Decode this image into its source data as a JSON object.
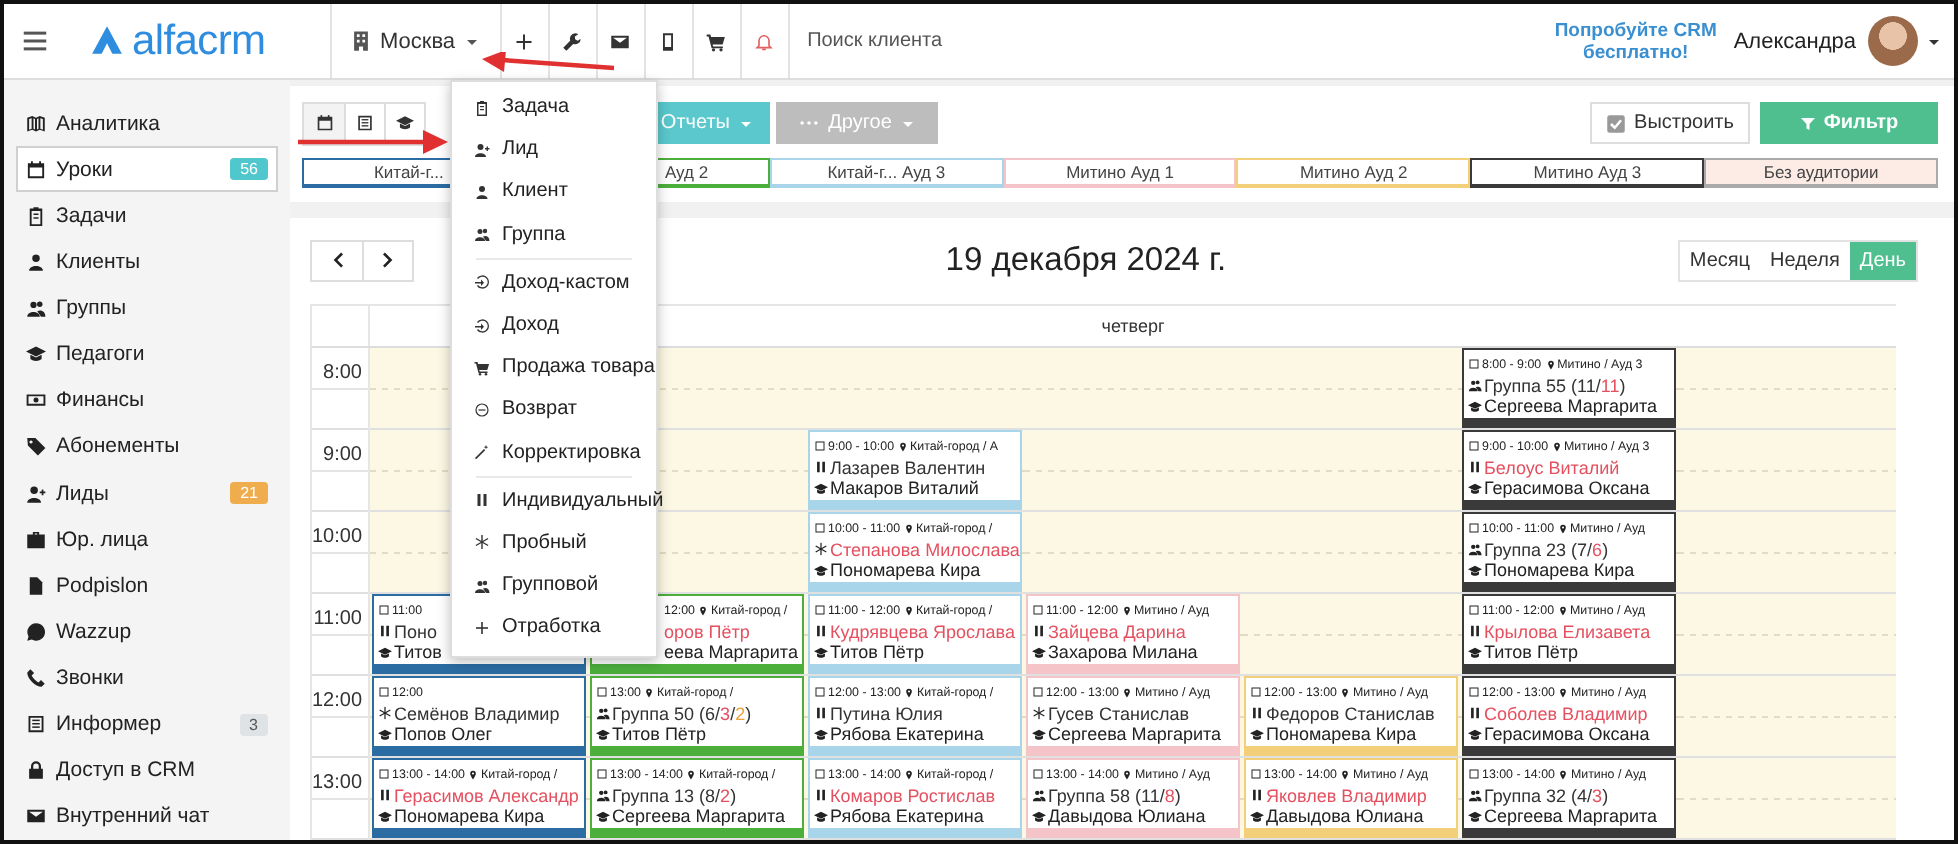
{
  "header": {
    "logo": "alfacrm",
    "city": "Москва",
    "search": {
      "placeholder": "Поиск клиента"
    },
    "promo": "Попробуйте CRM бесплатно!",
    "user": "Александра"
  },
  "sidebar": {
    "items": [
      {
        "label": "Аналитика",
        "selected": false
      },
      {
        "label": "Уроки",
        "selected": true,
        "badge": {
          "text": "56",
          "color": "#4fc7cc"
        }
      },
      {
        "label": "Задачи",
        "selected": false
      },
      {
        "label": "Клиенты",
        "selected": false
      },
      {
        "label": "Группы",
        "selected": false
      },
      {
        "label": "Педагоги",
        "selected": false
      },
      {
        "label": "Финансы",
        "selected": false
      },
      {
        "label": "Абонементы",
        "selected": false
      },
      {
        "label": "Лиды",
        "selected": false,
        "badge": {
          "text": "21",
          "color": "#f0ad4e"
        }
      },
      {
        "label": "Юр. лица",
        "selected": false
      },
      {
        "label": "Podpislon",
        "selected": false
      },
      {
        "label": "Wazzup",
        "selected": false
      },
      {
        "label": "Звонки",
        "selected": false
      },
      {
        "label": "Информер",
        "selected": false,
        "badge": {
          "text": "3",
          "color": "#dfe3e6"
        }
      },
      {
        "label": "Доступ в CRM",
        "selected": false
      },
      {
        "label": "Внутренний чат",
        "selected": false
      }
    ]
  },
  "add_menu": {
    "sections": [
      [
        {
          "label": "Задача"
        },
        {
          "label": "Лид"
        },
        {
          "label": "Клиент"
        },
        {
          "label": "Группа"
        }
      ],
      [
        {
          "label": "Доход-кастом"
        },
        {
          "label": "Доход"
        },
        {
          "label": "Продажа товара"
        },
        {
          "label": "Возврат"
        },
        {
          "label": "Корректировка"
        }
      ],
      [
        {
          "label": "Индивидуальный"
        },
        {
          "label": "Пробный"
        },
        {
          "label": "Групповой"
        },
        {
          "label": "Отработка"
        }
      ]
    ]
  },
  "toolbar": {
    "reports_button": "Отчеты",
    "other_button": "Другое",
    "arrange": {
      "label": "Выстроить",
      "checked": true
    },
    "filter_button": "Фильтр"
  },
  "rooms_legend": [
    {
      "label": "Китай-г...",
      "color": "#2b6ca3"
    },
    {
      "label": "Ауд 2",
      "color": "#4caf3c"
    },
    {
      "label": "Китай-г... Ауд 3",
      "color": "#a9d5ea"
    },
    {
      "label": "Митино Ауд 1",
      "color": "#f5c4c8"
    },
    {
      "label": "Митино Ауд 2",
      "color": "#f3cf7a"
    },
    {
      "label": "Митино Ауд 3",
      "color": "#3a3a3a"
    },
    {
      "label": "Без аудитории",
      "color": "#aaaaaa"
    }
  ],
  "calendar": {
    "title": "19 декабря 2024 г.",
    "views": [
      {
        "label": "Месяц",
        "selected": false
      },
      {
        "label": "Неделя",
        "selected": false
      },
      {
        "label": "День",
        "selected": true
      }
    ],
    "day": "четверг",
    "hours": [
      "8:00",
      "9:00",
      "10:00",
      "11:00",
      "12:00",
      "13:00"
    ],
    "columns": [
      {
        "color": "#2b6ca3",
        "cells": [
          {
            "kind": "empty"
          },
          {
            "kind": "empty"
          },
          {
            "kind": "empty"
          },
          {
            "kind": "individual",
            "time": "11:00",
            "name_parts": [
              {
                "text": "Поно",
                "color": "#333333"
              }
            ],
            "teacher": "Титов"
          },
          {
            "kind": "trial",
            "time": "12:00",
            "name_parts": [
              {
                "text": "Семёнов Владимир",
                "color": "#333333"
              }
            ],
            "teacher": "Попов Олег"
          },
          {
            "kind": "individual",
            "time": "13:00 - 14:00",
            "location": "Китай-город /",
            "name_parts": [
              {
                "text": "Герасимов Александр",
                "color": "#e4505f"
              }
            ],
            "teacher": "Пономарева Кира"
          }
        ]
      },
      {
        "color": "#4caf3c",
        "cells": [
          {
            "kind": "empty"
          },
          {
            "kind": "empty"
          },
          {
            "kind": "empty"
          },
          {
            "kind": "unknown",
            "time": "12:00",
            "location": "Китай-город /",
            "name_parts": [
              {
                "text": "оров Пётр",
                "color": "#e4505f"
              }
            ],
            "teacher": "еева Маргарита"
          },
          {
            "kind": "group",
            "time": "13:00",
            "location": "Китай-город /",
            "name_parts": [
              {
                "text": "Группа 50 (6/",
                "color": "#333333"
              },
              {
                "text": "3",
                "color": "#e4505f"
              },
              {
                "text": "/",
                "color": "#333333"
              },
              {
                "text": "2",
                "color": "#eea236"
              },
              {
                "text": ")",
                "color": "#333333"
              }
            ],
            "teacher": "Титов Пётр"
          },
          {
            "kind": "group",
            "time": "13:00 - 14:00",
            "location": "Китай-город /",
            "name_parts": [
              {
                "text": "Группа 13 (8/",
                "color": "#333333"
              },
              {
                "text": "2",
                "color": "#e4505f"
              },
              {
                "text": ")",
                "color": "#333333"
              }
            ],
            "teacher": "Сергеева Маргарита"
          }
        ]
      },
      {
        "color": "#a9d5ea",
        "cells": [
          {
            "kind": "empty"
          },
          {
            "kind": "individual",
            "time": "9:00 - 10:00",
            "location": "Китай-город / А",
            "name_parts": [
              {
                "text": "Лазарев Валентин",
                "color": "#333333"
              }
            ],
            "teacher": "Макаров Виталий"
          },
          {
            "kind": "trial",
            "time": "10:00 - 11:00",
            "location": "Китай-город /",
            "name_parts": [
              {
                "text": "Степанова Милослава",
                "color": "#e4505f"
              }
            ],
            "teacher": "Пономарева Кира"
          },
          {
            "kind": "individual",
            "time": "11:00 - 12:00",
            "location": "Китай-город /",
            "name_parts": [
              {
                "text": "Кудрявцева Ярослава",
                "color": "#e4505f"
              }
            ],
            "teacher": "Титов Пётр"
          },
          {
            "kind": "individual",
            "time": "12:00 - 13:00",
            "location": "Китай-город /",
            "name_parts": [
              {
                "text": "Путина Юлия",
                "color": "#333333"
              }
            ],
            "teacher": "Рябова Екатерина"
          },
          {
            "kind": "individual",
            "time": "13:00 - 14:00",
            "location": "Китай-город /",
            "name_parts": [
              {
                "text": "Комаров Ростислав",
                "color": "#e4505f"
              }
            ],
            "teacher": "Рябова Екатерина"
          }
        ]
      },
      {
        "color": "#f5c4c8",
        "cells": [
          {
            "kind": "empty"
          },
          {
            "kind": "empty"
          },
          {
            "kind": "empty"
          },
          {
            "kind": "individual",
            "time": "11:00 - 12:00",
            "location": "Митино / Ауд",
            "name_parts": [
              {
                "text": "Зайцева Дарина",
                "color": "#e4505f"
              }
            ],
            "teacher": "Захарова Милана"
          },
          {
            "kind": "trial",
            "time": "12:00 - 13:00",
            "location": "Митино / Ауд",
            "name_parts": [
              {
                "text": "Гусев Станислав",
                "color": "#333333"
              }
            ],
            "teacher": "Сергеева Маргарита"
          },
          {
            "kind": "group",
            "time": "13:00 - 14:00",
            "location": "Митино / Ауд",
            "name_parts": [
              {
                "text": "Группа 58 (11/",
                "color": "#333333"
              },
              {
                "text": "8",
                "color": "#e4505f"
              },
              {
                "text": ")",
                "color": "#333333"
              }
            ],
            "teacher": "Давыдова Юлиана"
          }
        ]
      },
      {
        "color": "#f3cf7a",
        "cells": [
          {
            "kind": "empty"
          },
          {
            "kind": "empty"
          },
          {
            "kind": "empty"
          },
          {
            "kind": "empty"
          },
          {
            "kind": "individual",
            "time": "12:00 - 13:00",
            "location": "Митино / Ауд",
            "name_parts": [
              {
                "text": "Федоров Станислав",
                "color": "#333333"
              }
            ],
            "teacher": "Пономарева Кира"
          },
          {
            "kind": "individual",
            "time": "13:00 - 14:00",
            "location": "Митино / Ауд",
            "name_parts": [
              {
                "text": "Яковлев Владимир",
                "color": "#e4505f"
              }
            ],
            "teacher": "Давыдова Юлиана"
          }
        ]
      },
      {
        "color": "#3a3a3a",
        "cells": [
          {
            "kind": "group",
            "time": "8:00 - 9:00",
            "location": "Митино / Ауд 3",
            "name_parts": [
              {
                "text": "Группа 55 (11/",
                "color": "#333333"
              },
              {
                "text": "11",
                "color": "#e4505f"
              },
              {
                "text": ")",
                "color": "#333333"
              }
            ],
            "teacher": "Сергеева Маргарита"
          },
          {
            "kind": "individual",
            "time": "9:00 - 10:00",
            "location": "Митино / Ауд 3",
            "name_parts": [
              {
                "text": "Белоус Виталий",
                "color": "#e4505f"
              }
            ],
            "teacher": "Герасимова Оксана"
          },
          {
            "kind": "group",
            "time": "10:00 - 11:00",
            "location": "Митино / Ауд",
            "name_parts": [
              {
                "text": "Группа 23 (7/",
                "color": "#333333"
              },
              {
                "text": "6",
                "color": "#e4505f"
              },
              {
                "text": ")",
                "color": "#333333"
              }
            ],
            "teacher": "Пономарева Кира"
          },
          {
            "kind": "individual",
            "time": "11:00 - 12:00",
            "location": "Митино / Ауд",
            "name_parts": [
              {
                "text": "Крылова Елизавета",
                "color": "#e4505f"
              }
            ],
            "teacher": "Титов Пётр"
          },
          {
            "kind": "individual",
            "time": "12:00 - 13:00",
            "location": "Митино / Ауд",
            "name_parts": [
              {
                "text": "Соболев Владимир",
                "color": "#e4505f"
              }
            ],
            "teacher": "Герасимова Оксана"
          },
          {
            "kind": "group",
            "time": "13:00 - 14:00",
            "location": "Митино / Ауд",
            "name_parts": [
              {
                "text": "Группа 32 (4/",
                "color": "#333333"
              },
              {
                "text": "3",
                "color": "#e4505f"
              },
              {
                "text": ")",
                "color": "#333333"
              }
            ],
            "teacher": "Сергеева Маргарита"
          }
        ]
      },
      {
        "cells": [
          {
            "kind": "empty"
          },
          {
            "kind": "empty"
          },
          {
            "kind": "empty"
          },
          {
            "kind": "empty"
          },
          {
            "kind": "empty"
          },
          {
            "kind": "empty"
          }
        ]
      }
    ]
  }
}
